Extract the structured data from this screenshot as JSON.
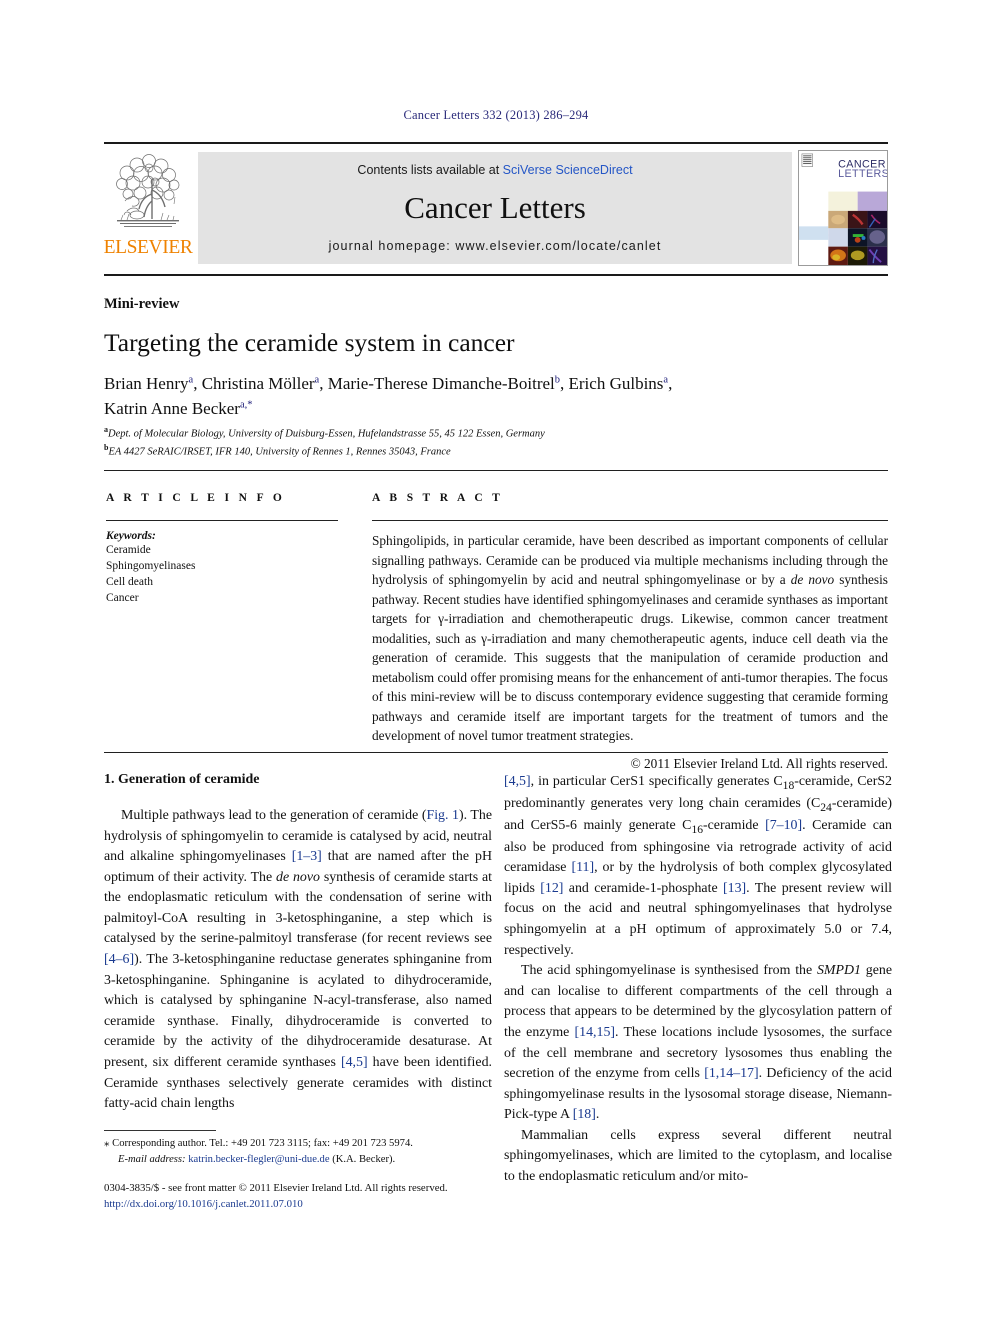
{
  "running_head": "Cancer Letters 332 (2013) 286–294",
  "masthead": {
    "publisher_name": "ELSEVIER",
    "contents_prefix": "Contents lists available at ",
    "contents_link": "SciVerse ScienceDirect",
    "journal_name": "Cancer Letters",
    "homepage_line": "journal homepage: www.elsevier.com/locate/canlet",
    "cover_title_line1": "CANCER",
    "cover_title_line2": "LETTERS"
  },
  "article": {
    "type": "Mini-review",
    "title": "Targeting the ceramide system in cancer",
    "authors_line1_parts": [
      {
        "name": "Brian Henry",
        "sup": "a"
      },
      {
        "name": "Christina Möller",
        "sup": "a"
      },
      {
        "name": "Marie-Therese Dimanche-Boitrel",
        "sup": "b"
      },
      {
        "name": "Erich Gulbins",
        "sup": "a"
      }
    ],
    "authors_line2_parts": [
      {
        "name": "Katrin Anne Becker",
        "sup": "a,*"
      }
    ],
    "affiliation_a_sup": "a",
    "affiliation_a": "Dept. of Molecular Biology, University of Duisburg-Essen, Hufelandstrasse 55, 45 122 Essen, Germany",
    "affiliation_b_sup": "b",
    "affiliation_b": "EA 4427 SeRAIC/IRSET, IFR 140, University of Rennes 1, Rennes 35043, France"
  },
  "article_info": {
    "label": "A R T I C L E   I N F O",
    "keywords_label": "Keywords:",
    "keywords": [
      "Ceramide",
      "Sphingomyelinases",
      "Cell death",
      "Cancer"
    ]
  },
  "abstract": {
    "label": "A B S T R A C T",
    "text_part1": "Sphingolipids, in particular ceramide, have been described as important components of cellular signalling pathways. Ceramide can be produced via multiple mechanisms including through the hydrolysis of sphingomyelin by acid and neutral sphingomyelinase or by a ",
    "italic1": "de novo",
    "text_part2": " synthesis pathway. Recent studies have identified sphingomyelinases and ceramide synthases as important targets for γ-irradiation and chemotherapeutic drugs. Likewise, common cancer treatment modalities, such as γ-irradiation and many chemotherapeutic agents, induce cell death via the generation of ceramide. This suggests that the manipulation of ceramide production and metabolism could offer promising means for the enhancement of anti-tumor therapies. The focus of this mini-review will be to discuss contemporary evidence suggesting that ceramide forming pathways and ceramide itself are important targets for the treatment of tumors and the development of novel tumor treatment strategies.",
    "copyright": "© 2011 Elsevier Ireland Ltd. All rights reserved."
  },
  "body": {
    "section1_heading": "1. Generation of ceramide",
    "left_para1_a": "Multiple pathways lead to the generation of ceramide (",
    "left_para1_ref_fig": "Fig. 1",
    "left_para1_b": "). The hydrolysis of sphingomyelin to ceramide is catalysed by acid, neutral and alkaline sphingomyelinases ",
    "left_para1_ref1": "[1–3]",
    "left_para1_c": " that are named after the pH optimum of their activity. The ",
    "left_para1_italic1": "de novo",
    "left_para1_d": " synthesis of ceramide starts at the endoplasmatic reticulum with the condensation of serine with palmitoyl-CoA resulting in 3-ketosphinganine, a step which is catalysed by the serine-palmitoyl transferase (for recent reviews see ",
    "left_para1_ref2": "[4–6]",
    "left_para1_e": "). The 3-ketosphinganine reductase generates sphinganine from 3-ketosphinganine. Sphinganine is acylated to dihydroceramide, which is catalysed by sphinganine N-acyl-transferase, also named ceramide synthase. Finally, dihydroceramide is converted to ceramide by the activity of the dihydroceramide desaturase. At present, six different ceramide synthases ",
    "left_para1_ref3": "[4,5]",
    "left_para1_f": " have been identified. Ceramide synthases selectively generate ceramides with distinct fatty-acid chain lengths",
    "right_para1_ref1": "[4,5]",
    "right_para1_a": ", in particular CerS1 specifically generates C",
    "right_para1_sub1": "18",
    "right_para1_b": "-ceramide, CerS2 predominantly generates very long chain ceramides (C",
    "right_para1_sub2": "24",
    "right_para1_c": "-ceramide) and CerS5-6 mainly generate C",
    "right_para1_sub3": "16",
    "right_para1_d": "-ceramide ",
    "right_para1_ref2": "[7–10]",
    "right_para1_e": ". Ceramide can also be produced from sphingosine via retrograde activity of acid ceramidase ",
    "right_para1_ref3": "[11]",
    "right_para1_f": ", or by the hydrolysis of both complex glycosylated lipids ",
    "right_para1_ref4": "[12]",
    "right_para1_g": " and ceramide-1-phosphate ",
    "right_para1_ref5": "[13]",
    "right_para1_h": ". The present review will focus on the acid and neutral sphingomyelinases that hydrolyse sphingomyelin at a pH optimum of approximately 5.0 or 7.4, respectively.",
    "right_para2_a": "The acid sphingomyelinase is synthesised from the ",
    "right_para2_italic1": "SMPD1",
    "right_para2_b": " gene and can localise to different compartments of the cell through a process that appears to be determined by the glycosylation pattern of the enzyme ",
    "right_para2_ref1": "[14,15]",
    "right_para2_c": ". These locations include lysosomes, the surface of the cell membrane and secretory lysosomes thus enabling the secretion of the enzyme from cells ",
    "right_para2_ref2": "[1,14–17]",
    "right_para2_d": ". Deficiency of the acid sphingomyelinase results in the lysosomal storage disease, Niemann-Pick-type A ",
    "right_para2_ref3": "[18]",
    "right_para2_e": ".",
    "right_para3": "Mammalian cells express several different neutral sphingomyelinases, which are limited to the cytoplasm, and localise to the endoplasmatic reticulum and/or mito-"
  },
  "footer": {
    "corresponding_star": "⁎",
    "corresponding_text": " Corresponding author. Tel.: +49 201 723 3115; fax: +49 201 723 5974.",
    "email_label": "E-mail address:",
    "email": "katrin.becker-flegler@uni-due.de",
    "email_suffix": " (K.A. Becker).",
    "issn_line": "0304-3835/$ - see front matter © 2011 Elsevier Ireland Ltd. All rights reserved.",
    "doi_line": "http://dx.doi.org/10.1016/j.canlet.2011.07.010"
  },
  "colors": {
    "link_blue": "#2456c6",
    "ref_blue": "#1a3a8f",
    "elsevier_orange": "#ef8200",
    "masthead_gray": "#e3e3e3"
  }
}
